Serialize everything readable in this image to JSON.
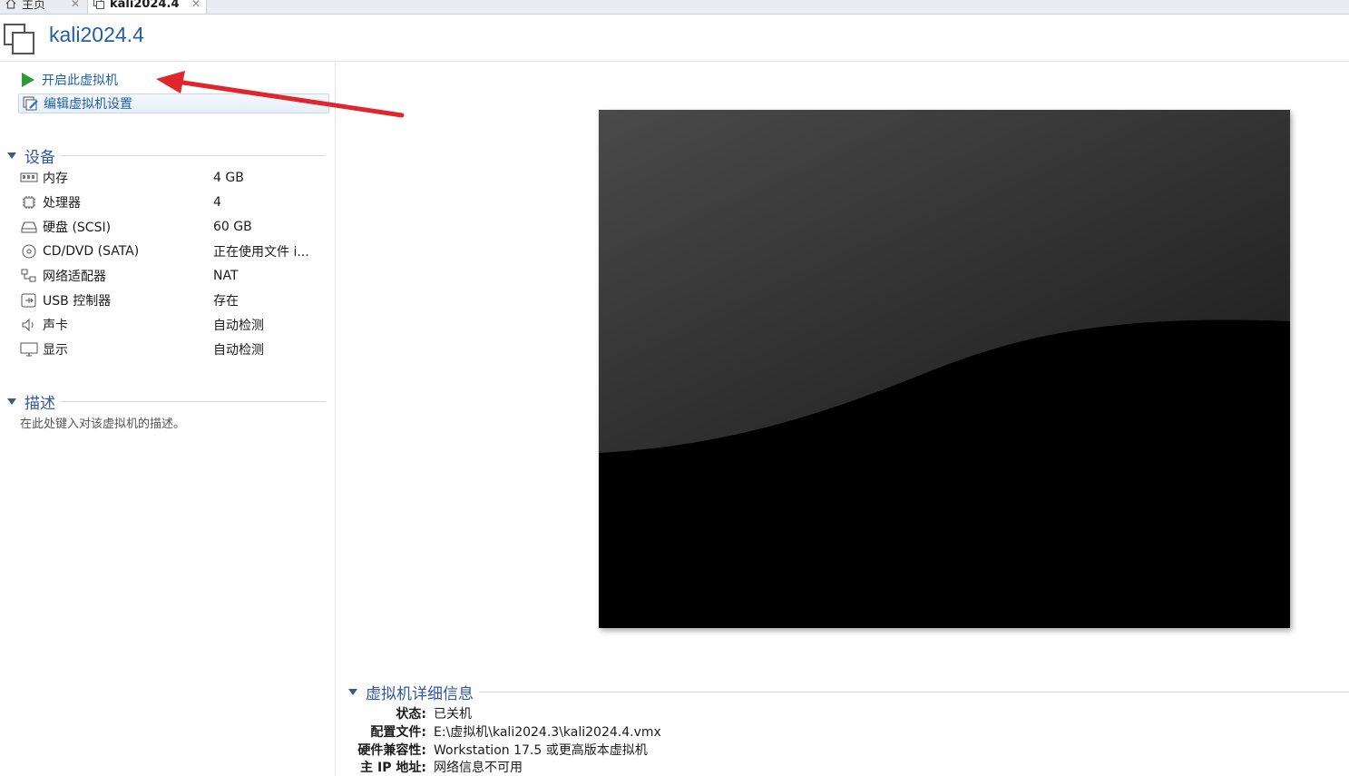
{
  "tabs": [
    {
      "label": "主页",
      "close": "✕"
    },
    {
      "label": "kali2024.4",
      "close": "✕"
    }
  ],
  "vm_title": "kali2024.4",
  "actions": {
    "start_label": "开启此虚拟机",
    "edit_label": "编辑虚拟机设置"
  },
  "devices_section": "设备",
  "devices": [
    {
      "icon": "memory-icon",
      "name": "内存",
      "value": "4 GB"
    },
    {
      "icon": "processor-icon",
      "name": "处理器",
      "value": "4"
    },
    {
      "icon": "hard-disk-icon",
      "name": "硬盘 (SCSI)",
      "value": "60 GB"
    },
    {
      "icon": "cd-dvd-icon",
      "name": "CD/DVD (SATA)",
      "value": "正在使用文件 i..."
    },
    {
      "icon": "network-adapter-icon",
      "name": "网络适配器",
      "value": "NAT"
    },
    {
      "icon": "usb-controller-icon",
      "name": "USB 控制器",
      "value": "存在"
    },
    {
      "icon": "sound-card-icon",
      "name": "声卡",
      "value": "自动检测"
    },
    {
      "icon": "display-icon",
      "name": "显示",
      "value": "自动检测"
    }
  ],
  "description_section": "描述",
  "description_placeholder": "在此处键入对该虚拟机的描述。",
  "details_section": "虚拟机详细信息",
  "details": [
    {
      "label": "状态:",
      "value": "已关机"
    },
    {
      "label": "配置文件:",
      "value": "E:\\虚拟机\\kali2024.3\\kali2024.4.vmx"
    },
    {
      "label": "硬件兼容性:",
      "value": "Workstation 17.5 或更高版本虚拟机"
    },
    {
      "label": "主 IP 地址:",
      "value": "网络信息不可用"
    }
  ],
  "colors": {
    "accent": "#1f5fa6",
    "section": "#2f58a0",
    "play": "#2e9b3a",
    "annotation_arrow": "#e0262c"
  }
}
